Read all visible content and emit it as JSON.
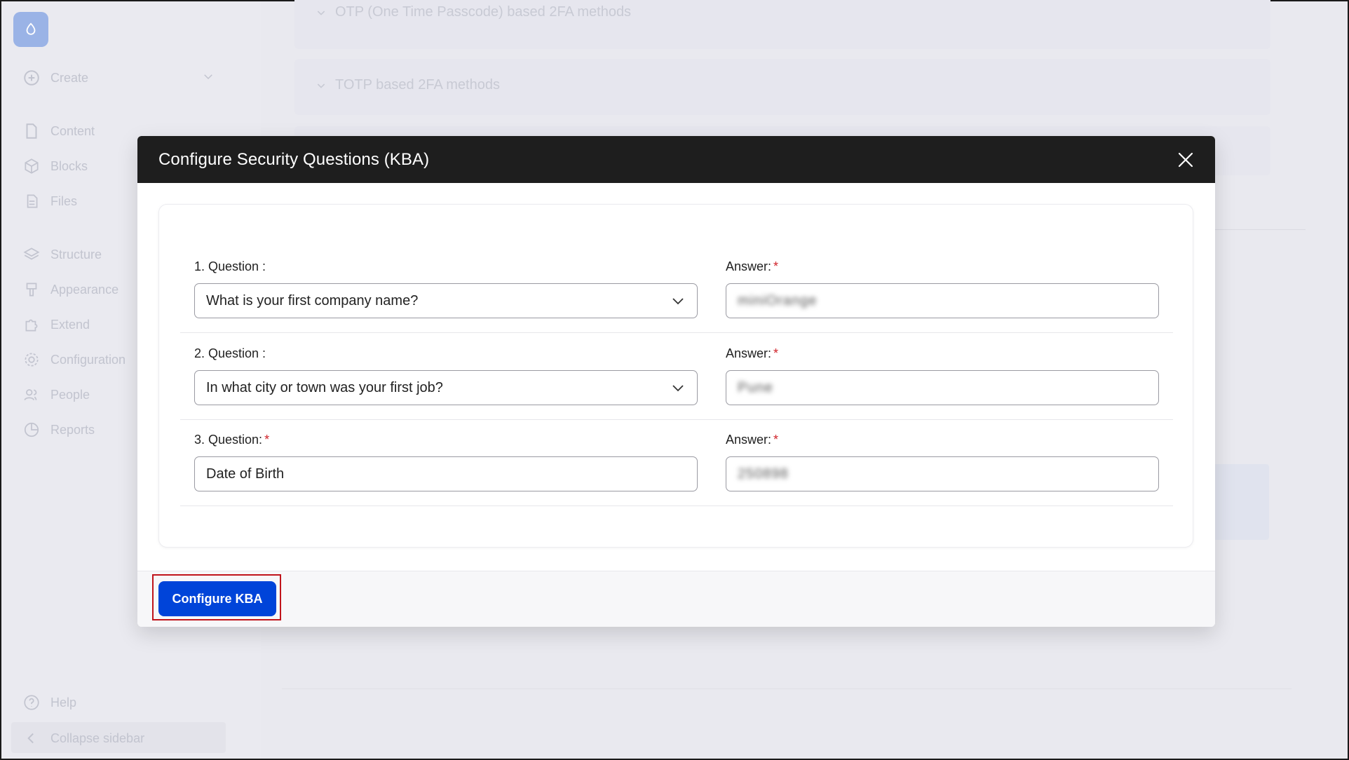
{
  "sidebar": {
    "create_label": "Create",
    "items": [
      {
        "label": "Content",
        "icon": "file-icon"
      },
      {
        "label": "Blocks",
        "icon": "cube-icon"
      },
      {
        "label": "Files",
        "icon": "files-icon"
      },
      {
        "label": "Structure",
        "icon": "layers-icon"
      },
      {
        "label": "Appearance",
        "icon": "brush-icon"
      },
      {
        "label": "Extend",
        "icon": "puzzle-icon"
      },
      {
        "label": "Configuration",
        "icon": "gear-icon"
      },
      {
        "label": "People",
        "icon": "people-icon"
      },
      {
        "label": "Reports",
        "icon": "pie-chart-icon"
      }
    ],
    "help_label": "Help",
    "collapse_label": "Collapse sidebar"
  },
  "background": {
    "panel_1": "OTP (One Time Passcode) based 2FA methods",
    "panel_2": "TOTP based 2FA methods"
  },
  "modal": {
    "title": "Configure Security Questions (KBA)",
    "rows": [
      {
        "question_label": "1. Question :",
        "question_value": "What is your first company name?",
        "question_type": "select",
        "question_required": false,
        "answer_label": "Answer:",
        "answer_value": "miniOrange"
      },
      {
        "question_label": "2. Question :",
        "question_value": "In what city or town was your first job?",
        "question_type": "select",
        "question_required": false,
        "answer_label": "Answer:",
        "answer_value": "Pune"
      },
      {
        "question_label": "3. Question:",
        "question_value": "Date of Birth",
        "question_type": "text",
        "question_required": true,
        "answer_label": "Answer:",
        "answer_value": "250898"
      }
    ],
    "submit_label": "Configure KBA"
  },
  "colors": {
    "header_bg": "#1e1e1e",
    "primary": "#0044d9",
    "required": "#d0242b",
    "focus_ring": "#c0141b"
  }
}
